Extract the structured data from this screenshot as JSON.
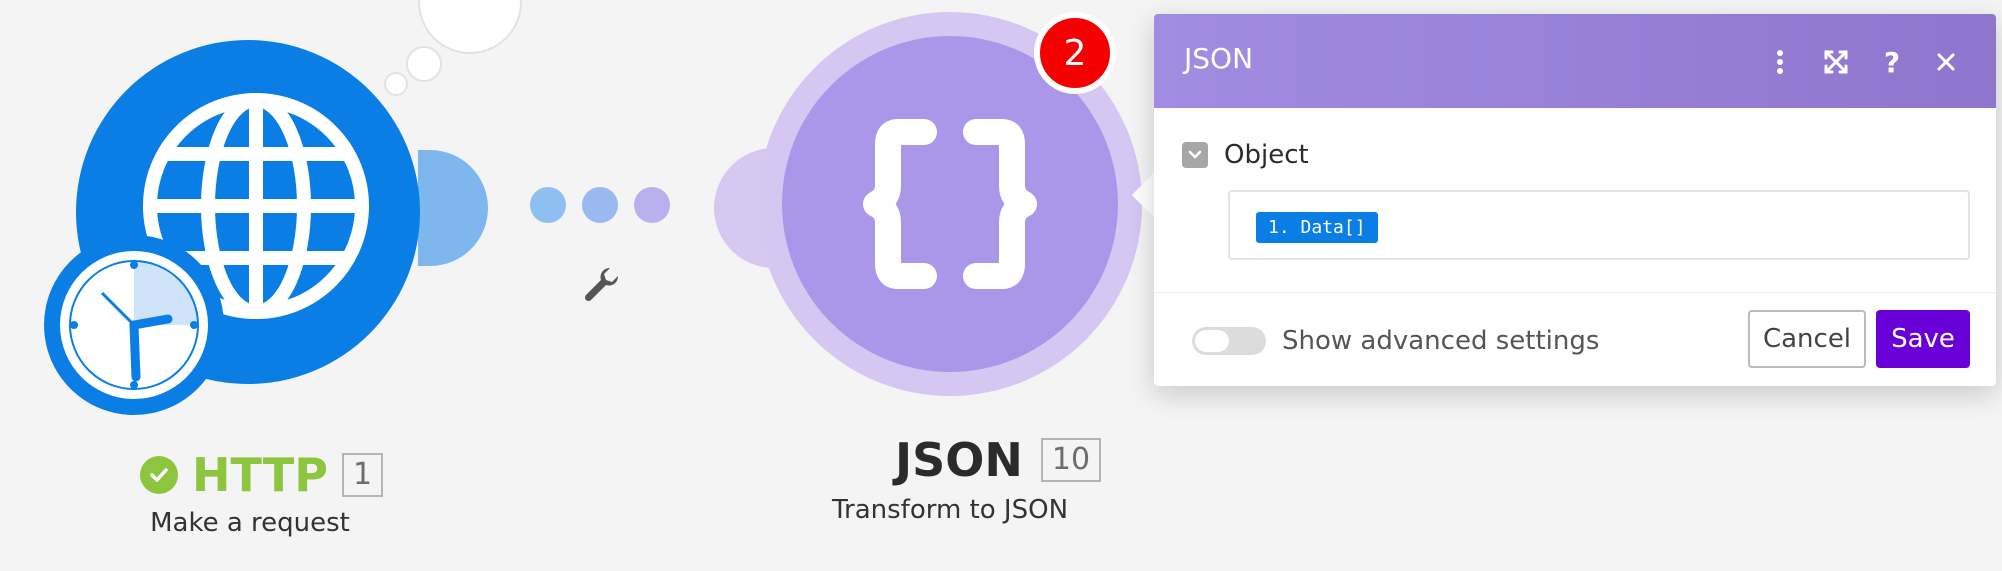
{
  "http_module": {
    "title": "HTTP",
    "id": "1",
    "subtitle": "Make a request",
    "status_icon": "check-circle-icon",
    "color": "#0a7ee4",
    "title_color": "#8cc63f"
  },
  "connector": {
    "dot_colors": [
      "#8dbff0",
      "#9ab9ef",
      "#b8b0ef"
    ],
    "tool_icon": "wrench-icon"
  },
  "json_module": {
    "title": "JSON",
    "id": "10",
    "subtitle": "Transform to JSON",
    "badge": "2",
    "color": "#ab97ea",
    "badge_color": "#f40000"
  },
  "panel": {
    "title": "JSON",
    "header_icons": [
      "more-vertical-icon",
      "expand-icon",
      "help-icon",
      "close-icon"
    ],
    "field": {
      "label": "Object",
      "value_pill": "1. Data[]"
    },
    "advanced_toggle_label": "Show advanced settings",
    "cancel_label": "Cancel",
    "save_label": "Save",
    "save_color": "#6a00d8"
  }
}
